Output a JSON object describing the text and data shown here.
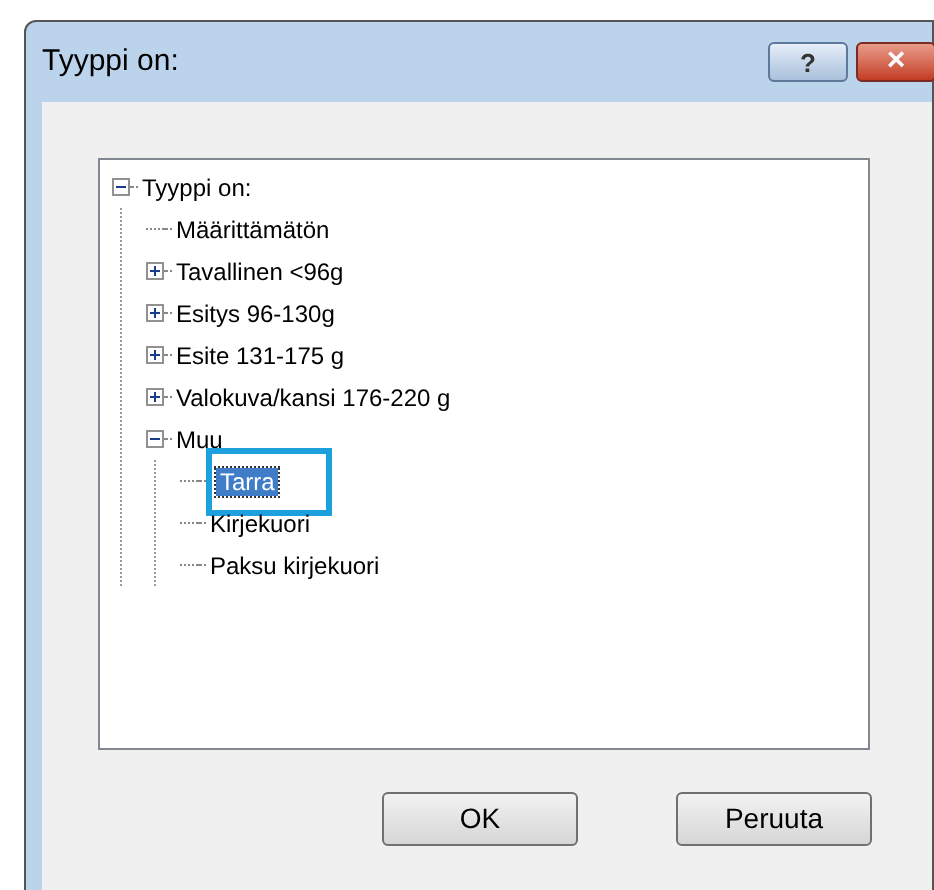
{
  "window": {
    "title": "Tyyppi on:",
    "title_buttons": [
      "?",
      "×"
    ]
  },
  "tree": [
    {
      "label": "Tyyppi on:",
      "expanded": true,
      "selected": false,
      "children": [
        {
          "label": "Määrittämätön",
          "selected": false
        },
        {
          "label": "Tavallinen <96g",
          "expanded": false,
          "selected": false
        },
        {
          "label": "Esitys 96-130g",
          "expanded": false,
          "selected": false
        },
        {
          "label": "Esite 131-175 g",
          "expanded": false,
          "selected": false
        },
        {
          "label": "Valokuva/kansi 176-220 g",
          "expanded": false,
          "selected": false
        },
        {
          "label": "Muu",
          "expanded": true,
          "selected": false,
          "children": [
            {
              "label": "Tarra",
              "selected": true
            },
            {
              "label": "Kirjekuori",
              "selected": false
            },
            {
              "label": "Paksu kirjekuori",
              "selected": false
            }
          ]
        }
      ]
    }
  ],
  "buttons": [
    "OK",
    "Peruuta"
  ]
}
